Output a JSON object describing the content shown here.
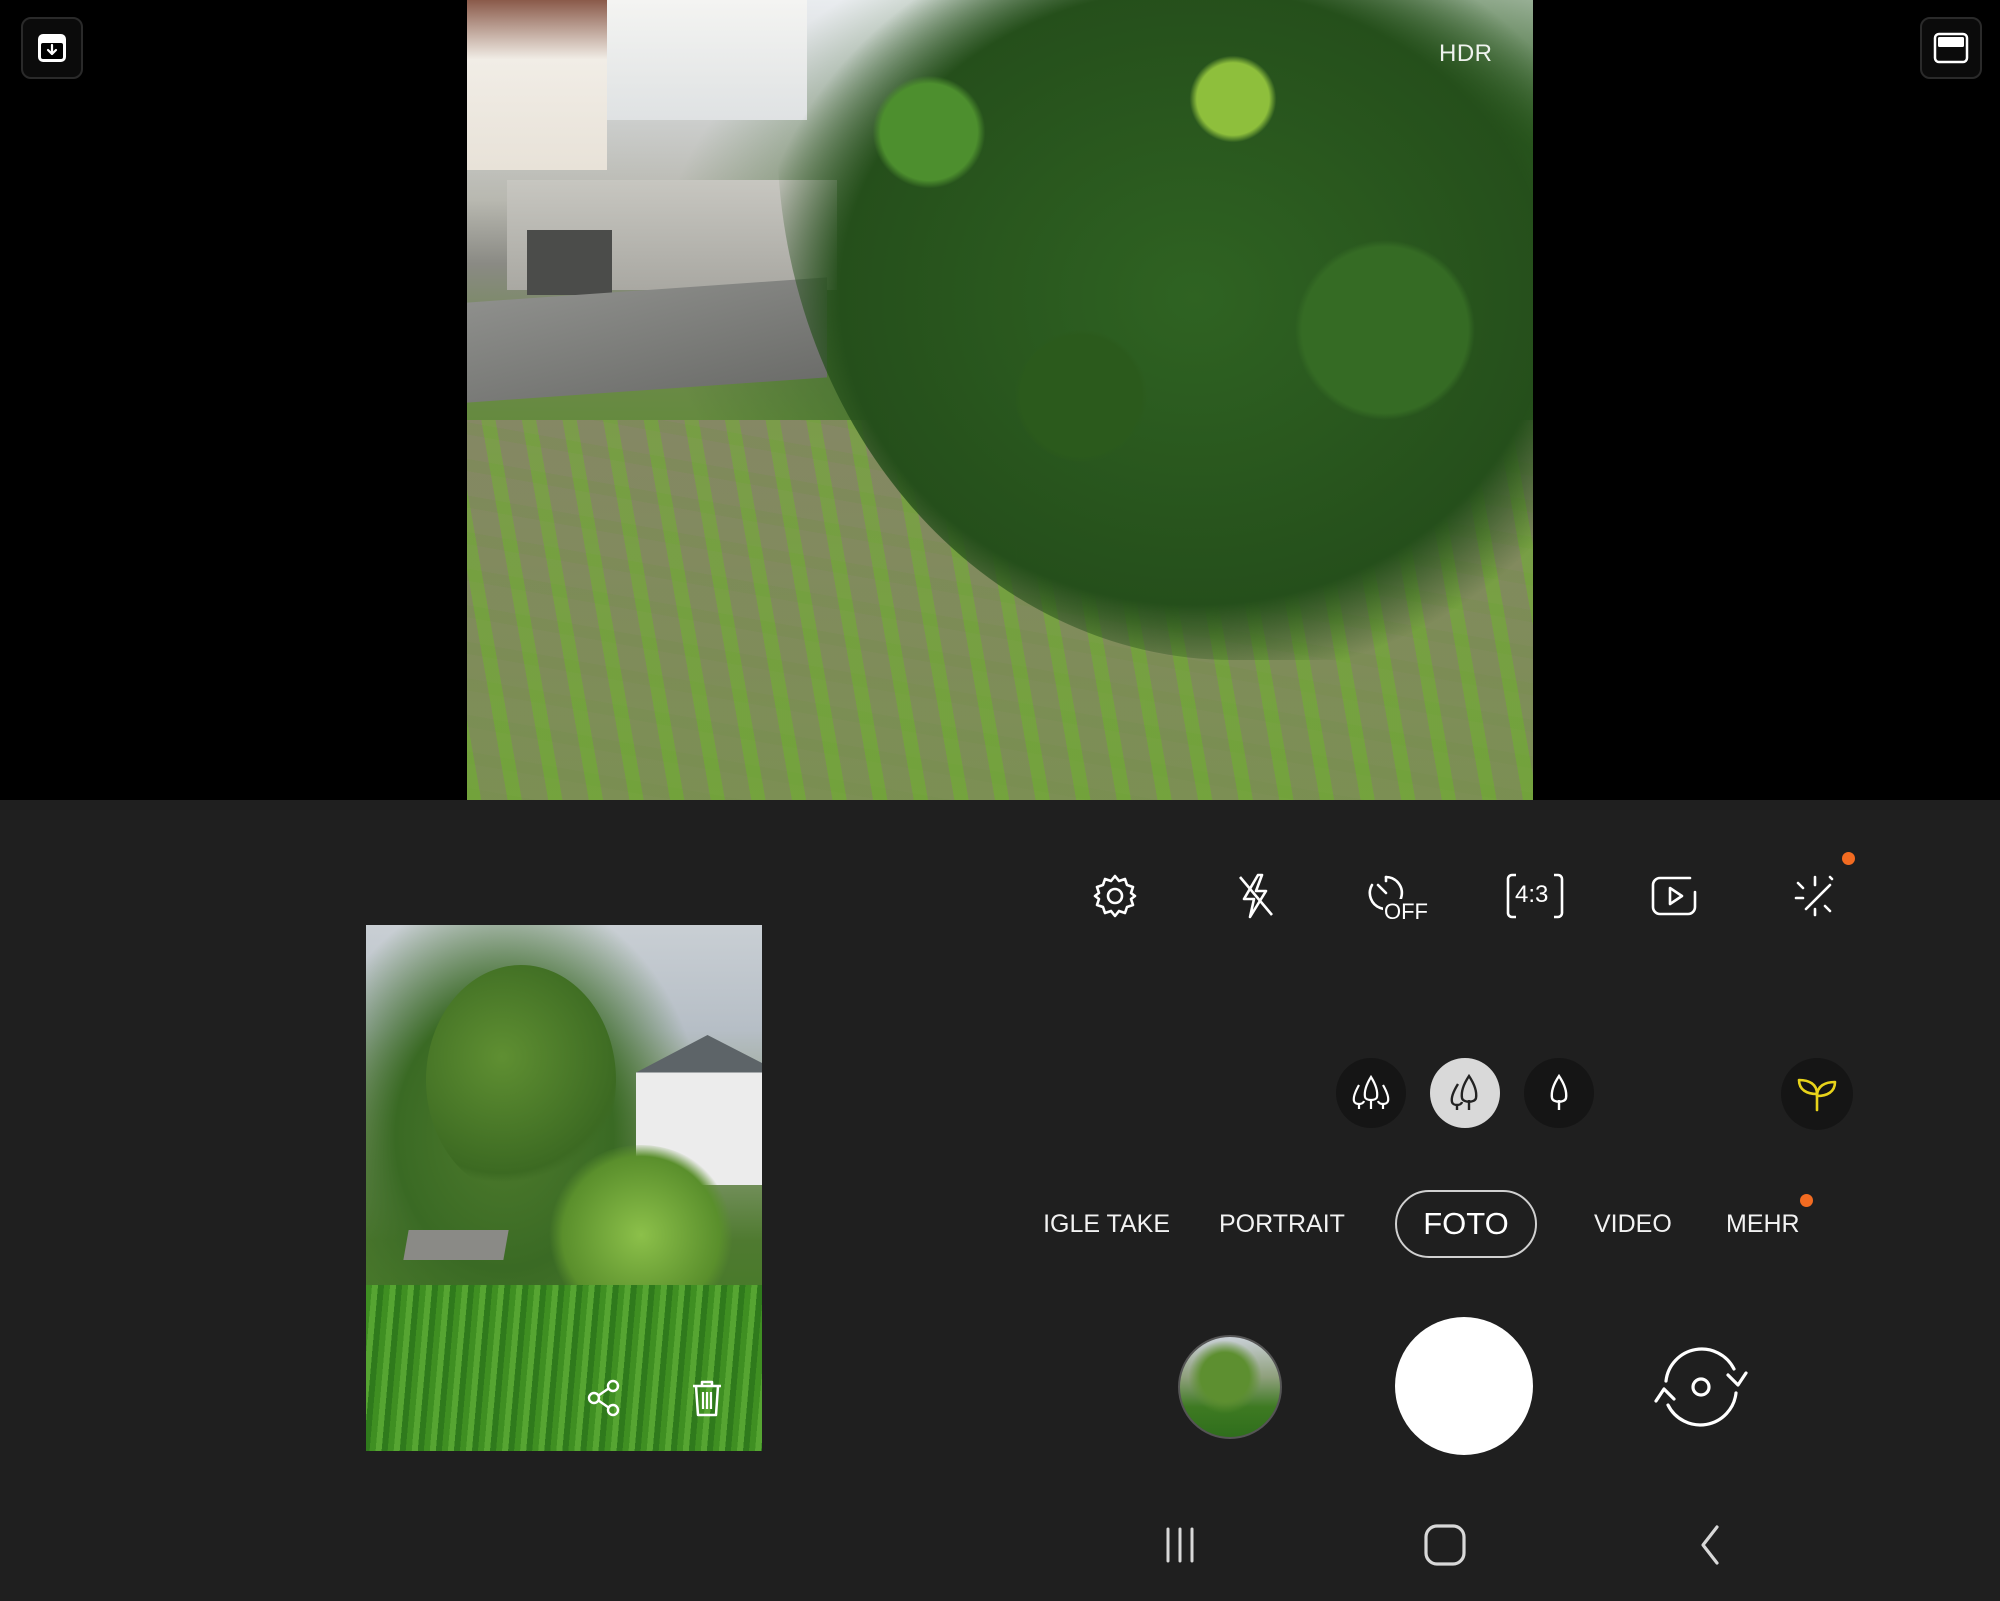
{
  "viewfinder": {
    "hdr_label": "HDR"
  },
  "toolbar": {
    "timer_label": "OFF",
    "ratio_label": "4:3"
  },
  "modes": {
    "items": [
      "SINGLE TAKE",
      "PORTRAIT",
      "FOTO",
      "VIDEO",
      "MEHR"
    ],
    "single_take_visible": "IGLE TAKE",
    "portrait": "PORTRAIT",
    "active": "FOTO",
    "video": "VIDEO",
    "more": "MEHR"
  },
  "colors": {
    "background": "#1f1f1f",
    "accent_dot": "#f26b21",
    "eco_icon": "#e8d31a",
    "lens_active": "#d9d9d9",
    "shutter": "#ffffff"
  },
  "icons": {
    "top_left": "capture-download-icon",
    "top_right": "window-mode-icon",
    "settings": "gear-icon",
    "flash": "flash-off-icon",
    "timer": "timer-off-icon",
    "ratio": "aspect-ratio-icon",
    "motion": "motion-photo-icon",
    "filters": "filters-sparkle-icon",
    "lens_ultra_wide": "three-trees-icon",
    "lens_wide": "two-trees-icon",
    "lens_tele": "one-tree-icon",
    "eco": "leaf-sprout-icon",
    "share": "share-icon",
    "trash": "trash-icon",
    "flip": "flip-camera-icon",
    "nav_recents": "recents-icon",
    "nav_home": "home-icon",
    "nav_back": "back-icon"
  }
}
